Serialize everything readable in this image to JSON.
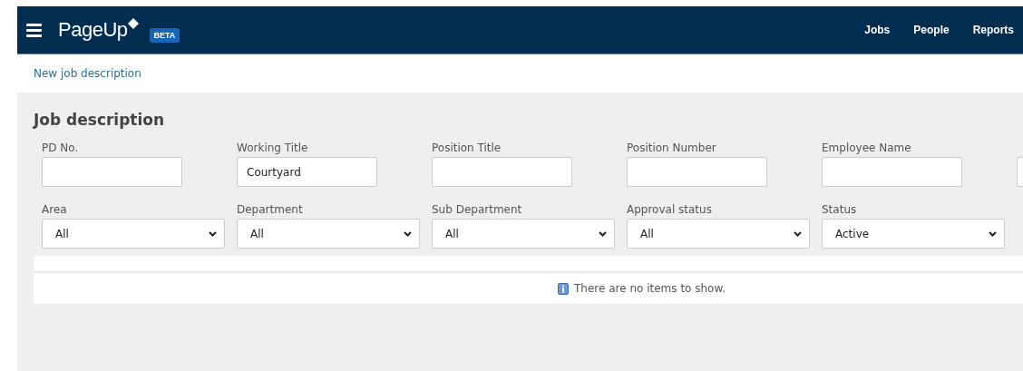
{
  "navbar": {
    "brand": "PageUp",
    "badge": "BETA",
    "links": [
      "Jobs",
      "People",
      "Reports"
    ]
  },
  "breadcrumb": {
    "link": "New job description"
  },
  "page": {
    "title": "Job description"
  },
  "filters": [
    {
      "kind": "text",
      "label": "PD No."
    },
    {
      "kind": "text",
      "label": "Working Title",
      "value": "Courtyard"
    },
    {
      "kind": "text",
      "label": "Position Title"
    },
    {
      "kind": "text",
      "label": "Position Number"
    },
    {
      "kind": "text",
      "label": "Employee Name"
    },
    {
      "kind": "text"
    },
    {
      "kind": "select",
      "label": "Area",
      "value": "All"
    },
    {
      "kind": "select",
      "label": "Department",
      "value": "All"
    },
    {
      "kind": "select",
      "label": "Sub Department",
      "value": "All"
    },
    {
      "kind": "select",
      "label": "Approval status",
      "value": "All"
    },
    {
      "kind": "select",
      "label": "Status",
      "value": "Active"
    }
  ],
  "results": {
    "message": "There are no items to show."
  }
}
